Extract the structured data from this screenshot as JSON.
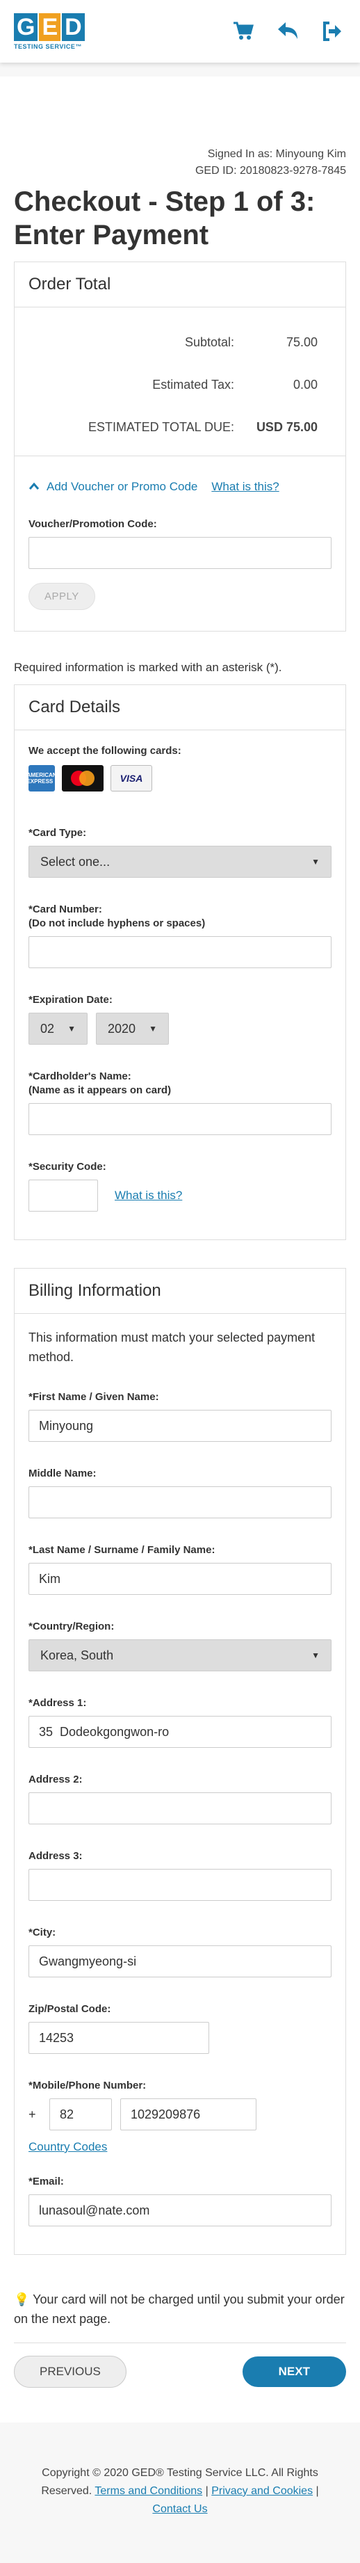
{
  "header": {
    "logo_letters": [
      "G",
      "E",
      "D"
    ],
    "logo_tagline": "TESTING SERVICE™",
    "icons": [
      "cart-icon",
      "back-arrow-icon",
      "sign-out-icon"
    ]
  },
  "account": {
    "signed_in": "Signed In as: Minyoung Kim",
    "ged_id": "GED ID: 20180823-9278-7845"
  },
  "page_title": "Checkout - Step 1 of 3: Enter Payment",
  "order_total": {
    "heading": "Order Total",
    "subtotal_label": "Subtotal:",
    "subtotal_value": "75.00",
    "tax_label": "Estimated Tax:",
    "tax_value": "0.00",
    "total_label": "ESTIMATED TOTAL DUE:",
    "total_value": "USD 75.00",
    "voucher_toggle": "Add Voucher or Promo Code",
    "voucher_what": "What is this?",
    "voucher_label": "Voucher/Promotion Code:",
    "voucher_value": "",
    "apply_button": "APPLY"
  },
  "required_note": "Required information is marked with an asterisk (*).",
  "card_details": {
    "heading": "Card Details",
    "accept_label": "We accept the following cards:",
    "card_logos": [
      "AMERICAN EXPRESS",
      "MasterCard",
      "VISA"
    ],
    "card_type_label": "*Card Type:",
    "card_type_value": "Select one...",
    "card_number_label": "*Card Number:",
    "card_number_hint": "(Do not include hyphens or spaces)",
    "card_number_value": "",
    "expiration_label": "*Expiration Date:",
    "exp_month": "02",
    "exp_year": "2020",
    "holder_label": "*Cardholder's Name:",
    "holder_hint": "(Name as it appears on card)",
    "holder_value": "",
    "security_label": "*Security Code:",
    "security_value": "",
    "security_what": "What is this?"
  },
  "billing": {
    "heading": "Billing Information",
    "info": "This information must match your selected payment method.",
    "first_label": "*First Name / Given Name:",
    "first_value": "Minyoung",
    "middle_label": "Middle Name:",
    "middle_value": "",
    "last_label": "*Last Name / Surname / Family Name:",
    "last_value": "Kim",
    "country_label": "*Country/Region:",
    "country_value": "Korea, South",
    "address1_label": "*Address 1:",
    "address1_value": "35  Dodeokgongwon-ro",
    "address2_label": "Address 2:",
    "address2_value": "",
    "address3_label": "Address 3:",
    "address3_value": "",
    "city_label": "*City:",
    "city_value": "Gwangmyeong-si",
    "zip_label": "Zip/Postal Code:",
    "zip_value": "14253",
    "phone_label": "*Mobile/Phone Number:",
    "phone_plus": "+",
    "phone_country": "82",
    "phone_number": "1029209876",
    "country_codes_link": "Country Codes",
    "email_label": "*Email:",
    "email_value": "lunasoul@nate.com"
  },
  "charge_note": "Your card will not be charged until you submit your order on the next page.",
  "nav": {
    "previous": "PREVIOUS",
    "next": "NEXT"
  },
  "footer": {
    "copyright": "Copyright © 2020 GED® Testing Service LLC. All Rights Reserved.",
    "terms": "Terms and Conditions",
    "separator": "|",
    "privacy": "Privacy and Cookies",
    "contact": "Contact Us"
  }
}
